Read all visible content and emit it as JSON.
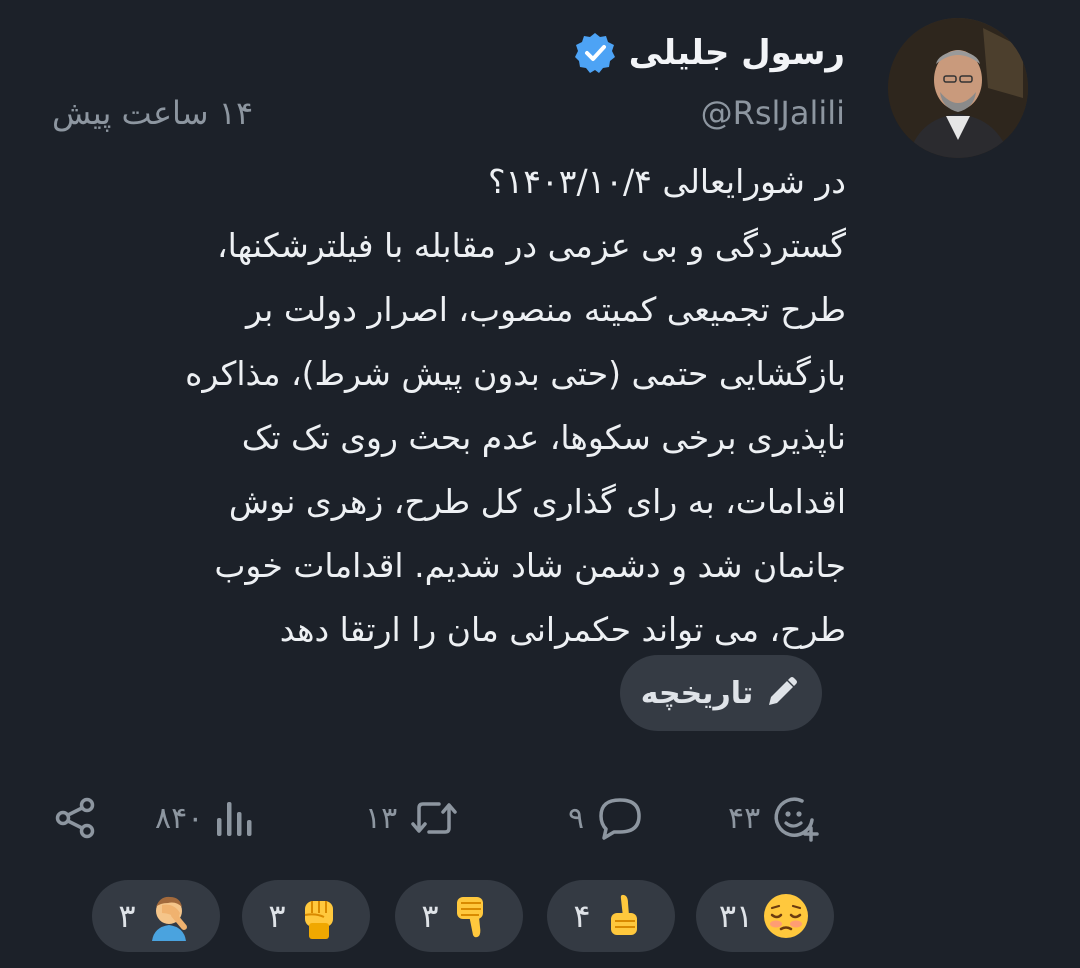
{
  "author": {
    "display_name": "رسول جلیلی",
    "handle": "@RslJalili",
    "verified_icon": "verified-badge-icon",
    "badge_color": "#4da3f5"
  },
  "post": {
    "time_ago": "۱۴ ساعت پیش",
    "lines": [
      "در شورایعالی ۱۴۰۳/۱۰/۴؟",
      "گستردگی و بی عزمی در مقابله با فیلترشکنها،",
      "طرح تجمیعی کمیته منصوب، اصرار دولت بر",
      "بازگشایی حتمی (حتی بدون پیش شرط)، مذاکره",
      "ناپذیری برخی سکوها، عدم بحث روی تک تک",
      "اقدامات، به رای گذاری کل طرح، زهری نوش",
      "جانمان شد و دشمن شاد شدیم. اقدامات خوب",
      "طرح، می تواند حکمرانی مان را ارتقا دهد"
    ],
    "history_label": "تاریخچه",
    "history_icon": "pencil-icon"
  },
  "actions": {
    "share_icon": "share-icon",
    "views": "۸۴۰",
    "views_icon": "bar-chart-icon",
    "reposts": "۱۳",
    "repost_icon": "repost-icon",
    "replies": "۹",
    "reply_icon": "comment-icon",
    "reactions": "۴۳",
    "reaction_icon": "add-reaction-icon"
  },
  "reactions": [
    {
      "emoji": "facepalm",
      "count": "۳"
    },
    {
      "emoji": "raised-fist",
      "count": "۳"
    },
    {
      "emoji": "thumbs-down",
      "count": "۳"
    },
    {
      "emoji": "thumbs-up",
      "count": "۴"
    },
    {
      "emoji": "pensive-face",
      "count": "۳۱"
    }
  ],
  "colors": {
    "background": "#1c2129",
    "muted_text": "#8d96a0",
    "pill": "#343a43"
  }
}
